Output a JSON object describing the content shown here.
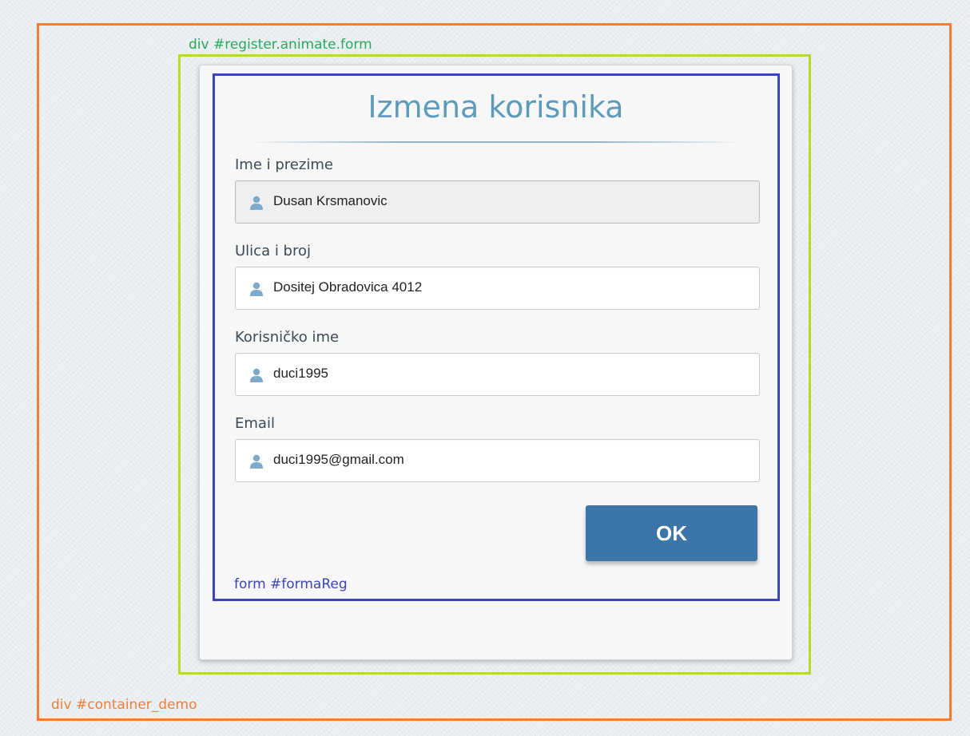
{
  "outlines": {
    "container_label": "div #container_demo",
    "register_label": "div #register.animate.form",
    "form_label": "form #formaReg"
  },
  "form": {
    "title": "Izmena korisnika",
    "fields": [
      {
        "label": "Ime i prezime",
        "value": "Dusan Krsmanovic",
        "icon": "user-icon"
      },
      {
        "label": "Ulica i broj",
        "value": "Dositej Obradovica 4012",
        "icon": "user-icon"
      },
      {
        "label": "Korisničko ime",
        "value": "duci1995",
        "icon": "user-icon"
      },
      {
        "label": "Email",
        "value": "duci1995@gmail.com",
        "icon": "user-icon"
      }
    ],
    "submit_label": "OK"
  },
  "colors": {
    "container_outline": "#f07e35",
    "register_outline": "#b9d92c",
    "form_outline": "#3b45b6",
    "title": "#5d9bba",
    "button": "#3c76a9",
    "icon": "#7ea9c9"
  }
}
